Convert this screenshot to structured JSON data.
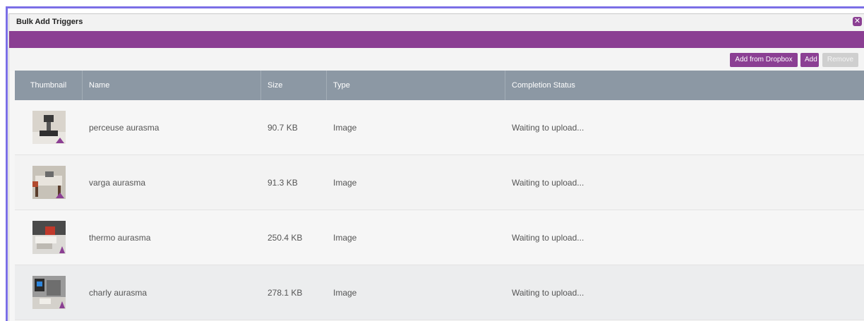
{
  "dialog": {
    "title": "Bulk Add Triggers",
    "close_icon": "close-x-icon"
  },
  "toolbar": {
    "dropbox_label": "Add from Dropbox",
    "add_label": "Add",
    "remove_label": "Remove"
  },
  "table": {
    "headers": [
      "Thumbnail",
      "Name",
      "Size",
      "Type",
      "Completion Status"
    ],
    "rows": [
      {
        "name": "perceuse aurasma",
        "size": "90.7 KB",
        "type": "Image",
        "status": "Waiting to upload..."
      },
      {
        "name": "varga aurasma",
        "size": "91.3 KB",
        "type": "Image",
        "status": "Waiting to upload..."
      },
      {
        "name": "thermo aurasma",
        "size": "250.4 KB",
        "type": "Image",
        "status": "Waiting to upload..."
      },
      {
        "name": "charly aurasma",
        "size": "278.1 KB",
        "type": "Image",
        "status": "Waiting to upload..."
      }
    ]
  },
  "colors": {
    "accent": "#8b3f93",
    "header": "#8c98a4",
    "frame": "#7b6fe6"
  }
}
